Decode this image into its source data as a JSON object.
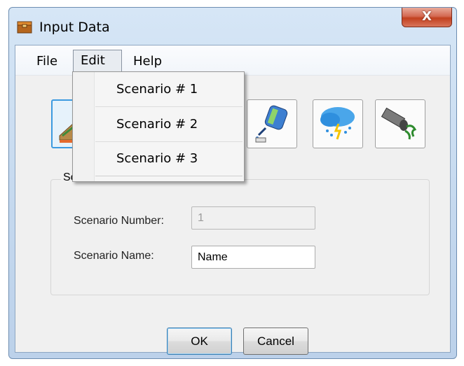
{
  "window": {
    "title": "Input Data",
    "close_glyph": "X",
    "icon": "app-box-icon"
  },
  "menu": {
    "file": "File",
    "edit": "Edit",
    "help": "Help"
  },
  "edit_menu": {
    "items": [
      "Scenario # 1",
      "Scenario # 2",
      "Scenario # 3"
    ]
  },
  "toolbar": {
    "buttons": [
      {
        "icon": "terrain-icon",
        "selected": true
      },
      {
        "icon": "watering-can-icon",
        "selected": false
      },
      {
        "icon": "rain-storm-icon",
        "selected": false
      },
      {
        "icon": "pipe-outflow-icon",
        "selected": false
      }
    ]
  },
  "scenario_group": {
    "legend": "Scenario",
    "number_label": "Scenario Number:",
    "number_value": "1",
    "name_label": "Scenario Name:",
    "name_value": "Name"
  },
  "buttons": {
    "ok": "OK",
    "cancel": "Cancel"
  },
  "colors": {
    "selection_border": "#3c9ae0",
    "close_red": "#c2401f",
    "frame_blue": "#c4d8ee"
  }
}
